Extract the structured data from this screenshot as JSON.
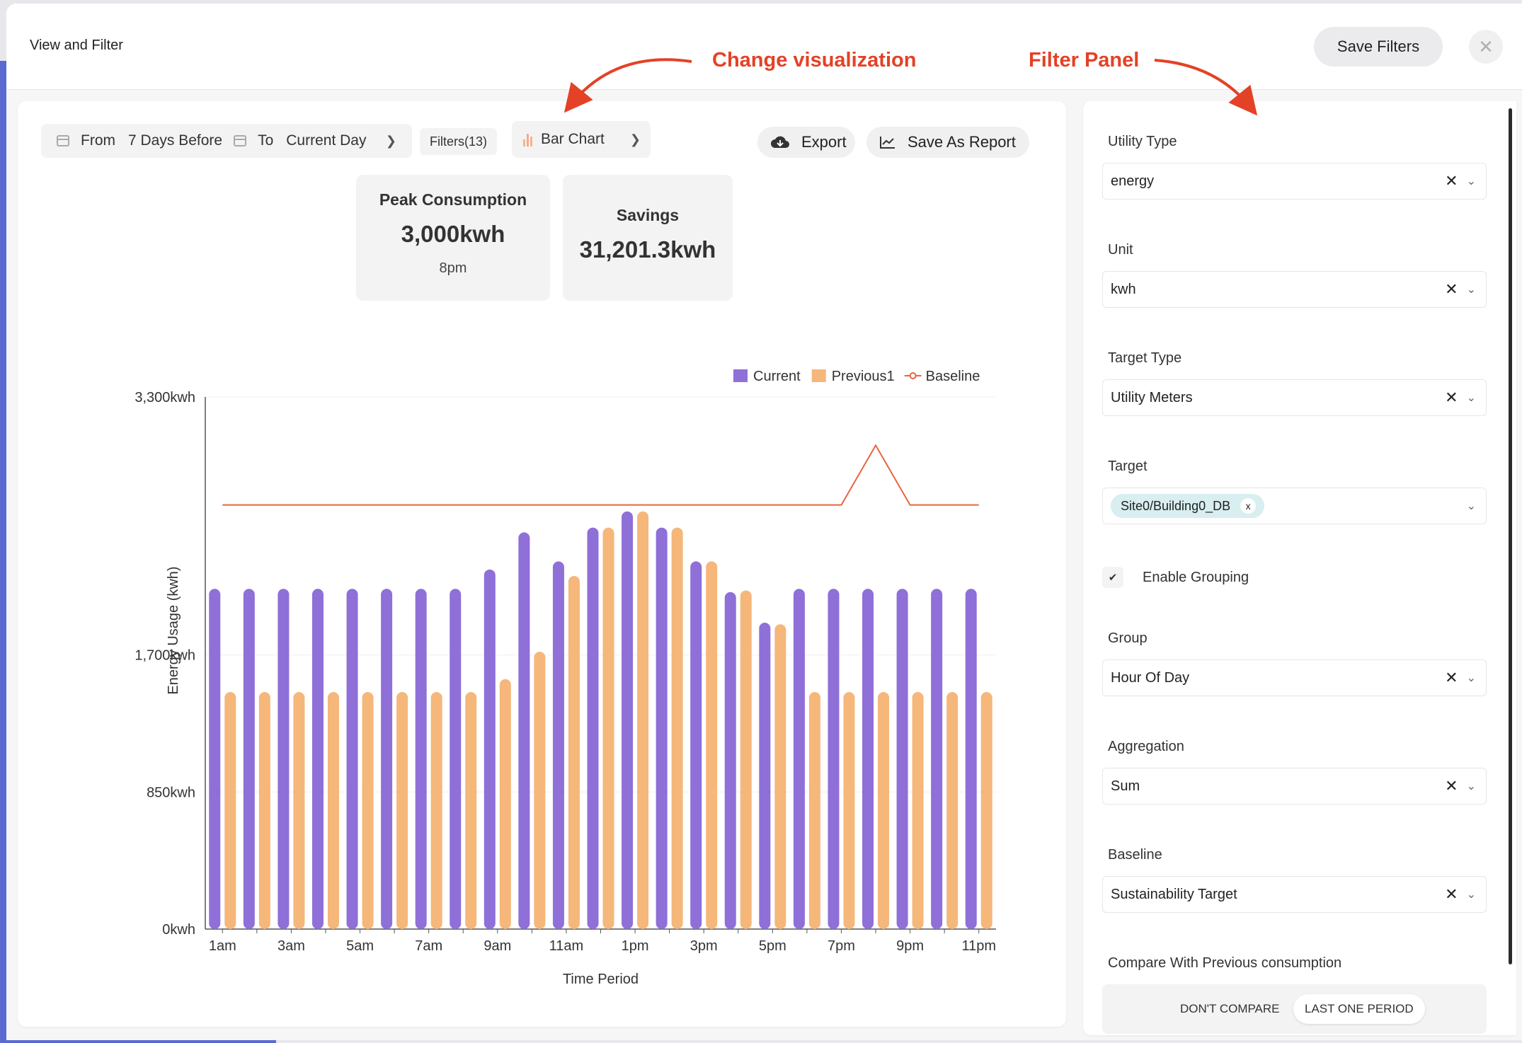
{
  "header": {
    "title": "View and Filter",
    "save_filters": "Save Filters",
    "close_icon": "close-icon"
  },
  "annotations": {
    "change_visualization": "Change visualization",
    "filter_panel": "Filter Panel"
  },
  "toolbar": {
    "from_label": "From",
    "from_value": "7 Days Before",
    "to_label": "To",
    "to_value": "Current Day",
    "filters_count": "Filters(13)",
    "chart_type": "Bar Chart",
    "export": "Export",
    "save_as_report": "Save As Report"
  },
  "stats": {
    "peak": {
      "title": "Peak Consumption",
      "value": "3,000kwh",
      "sub": "8pm"
    },
    "savings": {
      "title": "Savings",
      "value": "31,201.3kwh"
    }
  },
  "chart_data": {
    "type": "bar",
    "xlabel": "Time Period",
    "ylabel": "Energy Usage (kwh)",
    "ylim": [
      0,
      3300
    ],
    "y_ticks": [
      {
        "value": 0,
        "label": "0kwh"
      },
      {
        "value": 850,
        "label": "850kwh"
      },
      {
        "value": 1700,
        "label": "1,700kwh"
      },
      {
        "value": 3300,
        "label": "3,300kwh"
      }
    ],
    "categories": [
      "1am",
      "2am",
      "3am",
      "4am",
      "5am",
      "6am",
      "7am",
      "8am",
      "9am",
      "10am",
      "11am",
      "12pm",
      "1pm",
      "2pm",
      "3pm",
      "4pm",
      "5pm",
      "6pm",
      "7pm",
      "8pm",
      "9pm",
      "10pm",
      "11pm"
    ],
    "x_tick_labels": [
      "1am",
      "3am",
      "5am",
      "7am",
      "9am",
      "11am",
      "1pm",
      "3pm",
      "5pm",
      "7pm",
      "9pm",
      "11pm"
    ],
    "legend_position": "top-right",
    "series": [
      {
        "name": "Current",
        "type": "bar",
        "color": "#8f6fd8",
        "values": [
          2110,
          2110,
          2110,
          2110,
          2110,
          2110,
          2110,
          2110,
          2230,
          2460,
          2280,
          2490,
          2590,
          2490,
          2280,
          2090,
          1900,
          2110,
          2110,
          2110,
          2110,
          2110,
          2110
        ]
      },
      {
        "name": "Previous1",
        "type": "bar",
        "color": "#f5b77a",
        "values": [
          1470,
          1470,
          1470,
          1470,
          1470,
          1470,
          1470,
          1470,
          1550,
          1720,
          2190,
          2490,
          2590,
          2490,
          2280,
          2100,
          1890,
          1470,
          1470,
          1470,
          1470,
          1470,
          1470
        ]
      },
      {
        "name": "Baseline",
        "type": "line",
        "color": "#e8653f",
        "values": [
          2630,
          2630,
          2630,
          2630,
          2630,
          2630,
          2630,
          2630,
          2630,
          2630,
          2630,
          2630,
          2630,
          2630,
          2630,
          2630,
          2630,
          2630,
          2630,
          3000,
          2630,
          2630,
          2630
        ]
      }
    ]
  },
  "filters": {
    "utility_type": {
      "label": "Utility Type",
      "value": "energy"
    },
    "unit": {
      "label": "Unit",
      "value": "kwh"
    },
    "target_type": {
      "label": "Target Type",
      "value": "Utility Meters"
    },
    "target": {
      "label": "Target",
      "tag": "Site0/Building0_DB",
      "tag_x": "x"
    },
    "grouping": {
      "label": "Enable Grouping",
      "checked": true
    },
    "group": {
      "label": "Group",
      "value": "Hour Of Day"
    },
    "aggregation": {
      "label": "Aggregation",
      "value": "Sum"
    },
    "baseline": {
      "label": "Baseline",
      "value": "Sustainability Target"
    },
    "compare": {
      "label": "Compare With Previous consumption",
      "options": [
        "DON'T COMPARE",
        "LAST ONE PERIOD"
      ],
      "selected": "LAST ONE PERIOD"
    }
  },
  "colors": {
    "accent": "#5b6ad0",
    "annotation": "#e34226",
    "current": "#8f6fd8",
    "previous": "#f5b77a",
    "baseline": "#e8653f"
  }
}
